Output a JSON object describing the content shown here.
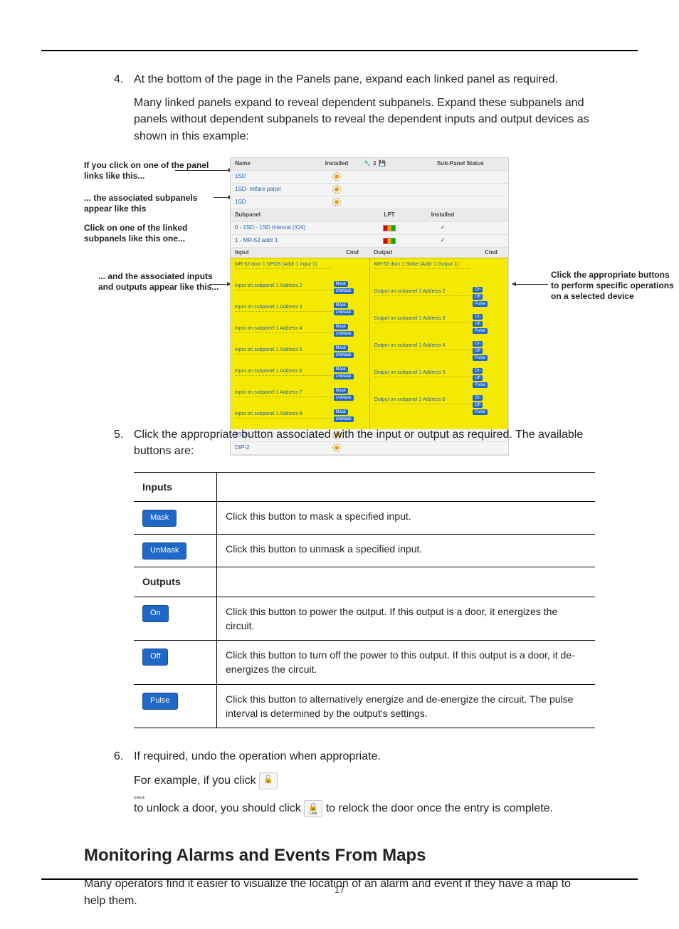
{
  "steps": {
    "s4": {
      "num": "4.",
      "p1": "At the bottom of the page in the Panels pane, expand each linked panel as required.",
      "p2": "Many linked panels expand to reveal dependent subpanels. Expand these subpanels and panels without dependent subpanels to reveal the dependent inputs and output devices as shown in this example:"
    },
    "s5": {
      "num": "5.",
      "p1": "Click the appropriate button associated with the input or output as required. The available buttons are:"
    },
    "s6": {
      "num": "6.",
      "p1": "If required, undo the operation when appropriate.",
      "p2a": "For example, if you click ",
      "p2b": " to unlock a door, you should click ",
      "p2c": " to relock the door once the entry is complete."
    }
  },
  "callouts": {
    "c1": "If you click on one of the panel links like this...",
    "c2": "... the associated subpanels appear like this",
    "c3": "Click on one of the linked subpanels like this one...",
    "c4": "... and the associated inputs and outputs appear like this...",
    "cr": "Click the appropriate buttons to perform specific operations on a selected device"
  },
  "panel": {
    "hdr": {
      "c1": "Name",
      "c2": "Installed",
      "c4": "Sub-Panel Status"
    },
    "rows": [
      {
        "c1": "1SD"
      },
      {
        "c1": "1SD- mifare panel"
      },
      {
        "c1": "1SD"
      }
    ],
    "sphdr": {
      "s1": "Subpanel",
      "s2": "LPT",
      "s3": "Installed"
    },
    "sprows": [
      {
        "s1": "0 - 1SD - 1SD Internal (IO4)"
      },
      {
        "s1": "1 - MR-52 addr 1"
      }
    ],
    "iohdr_in": {
      "h1": "Input",
      "h2": "Cmd"
    },
    "iohdr_out": {
      "h1": "Output",
      "h2": "Cmd"
    },
    "in_items": [
      "MR-52 door 1 DPOS (Addr 1 Input 1)",
      "Input on subpanel 1 Address 2",
      "Input on subpanel 1 Address 3",
      "Input on subpanel 1 Address 4",
      "Input on subpanel 1 Address 5",
      "Input on subpanel 1 Address 6",
      "Input on subpanel 1 Address 7",
      "Input on subpanel 1 Address 8"
    ],
    "out_items": [
      "MR-52 door 1 Strike (Addr 1 Output 1)",
      "Output on subpanel 1 Address 2",
      "Output on subpanel 1 Address 3",
      "Output on subpanel 1 Address 4",
      "Output on subpanel 1 Address 5",
      "Output on subpanel 1 Address 6"
    ],
    "footrows": [
      {
        "c1": "2SD"
      },
      {
        "c1": "DIP-2"
      }
    ],
    "btn_mask": "Mask",
    "btn_unmask": "UnMask",
    "btn_on": "On",
    "btn_off": "Off",
    "btn_pulse": "Pulse"
  },
  "table": {
    "inputs_h": "Inputs",
    "outputs_h": "Outputs",
    "mask": {
      "btn": "Mask",
      "txt": "Click this button to mask a specified input."
    },
    "unmask": {
      "btn": "UnMask",
      "txt": "Click this button to unmask a specified input."
    },
    "on": {
      "btn": "On",
      "txt": "Click this button to power the output. If this output is a door, it energizes the circuit."
    },
    "off": {
      "btn": "Off",
      "txt": "Click this button to turn off the power to this output. If this output is a door, it de-energizes the circuit."
    },
    "pulse": {
      "btn": "Pulse",
      "txt": "Click this button to alternatively energize and de-energize the circuit. The pulse interval is determined by the output's settings."
    }
  },
  "section": {
    "h2": "Monitoring Alarms and Events From Maps",
    "para": "Many operators find it easier to visualize the location of an alarm and event if they have a map to help them."
  },
  "page_number": "17",
  "icons": {
    "unlock_sub": "Unlock",
    "lock_sub": "Lock"
  }
}
